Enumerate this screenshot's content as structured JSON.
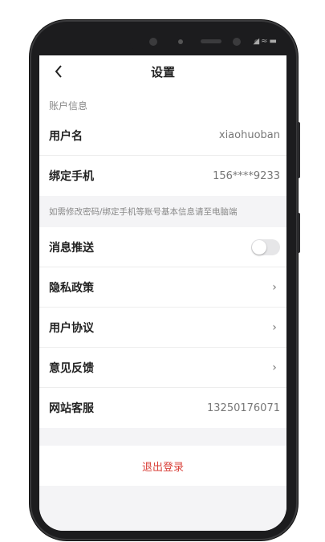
{
  "nav": {
    "title": "设置"
  },
  "account": {
    "section_label": "账户信息",
    "username_label": "用户名",
    "username_value": "xiaohuoban",
    "phone_label": "绑定手机",
    "phone_value": "156****9233"
  },
  "hint": "如需修改密码/绑定手机等账号基本信息请至电脑端",
  "settings": {
    "push_label": "消息推送",
    "push_enabled": false,
    "privacy_label": "隐私政策",
    "agreement_label": "用户协议",
    "feedback_label": "意见反馈",
    "service_label": "网站客服",
    "service_value": "13250176071",
    "chevron": "›"
  },
  "logout_label": "退出登录",
  "colors": {
    "accent_red": "#d9413a",
    "background": "#f4f4f6",
    "toggle_off": "#e6e6e8"
  }
}
